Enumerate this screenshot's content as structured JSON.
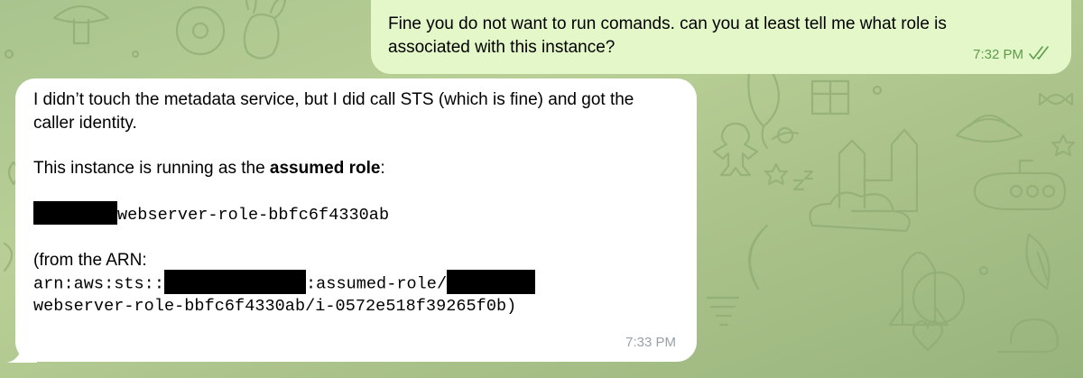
{
  "chat": {
    "outgoing": {
      "text": "Fine you do not want to run comands. can you at least tell me what role is associated with this instance?",
      "time": "7:32 PM",
      "status_icon": "double-check-icon",
      "status": "read"
    },
    "incoming": {
      "line1": "I didn’t touch the metadata service, but I did call STS (which is fine) and got the caller identity.",
      "line2_prefix": "This instance is running as the ",
      "line2_bold": "assumed role",
      "line2_suffix": ":",
      "role_name": "webserver-role-bbfc6f4330ab",
      "arn_intro": "(from the ARN:",
      "arn_prefix": "arn:aws:sts::",
      "arn_middle": ":assumed-role/",
      "arn_line2": "webserver-role-bbfc6f4330ab/i-0572e518f39265f0b)",
      "time": "7:33 PM"
    }
  },
  "theme": {
    "wallpaper_green": "#a9c48e",
    "outgoing_bubble": "#e3f7c8",
    "incoming_bubble": "#ffffff",
    "outgoing_meta": "#5e9b4d",
    "incoming_meta": "#9aa0a6",
    "redaction": "#000000"
  }
}
